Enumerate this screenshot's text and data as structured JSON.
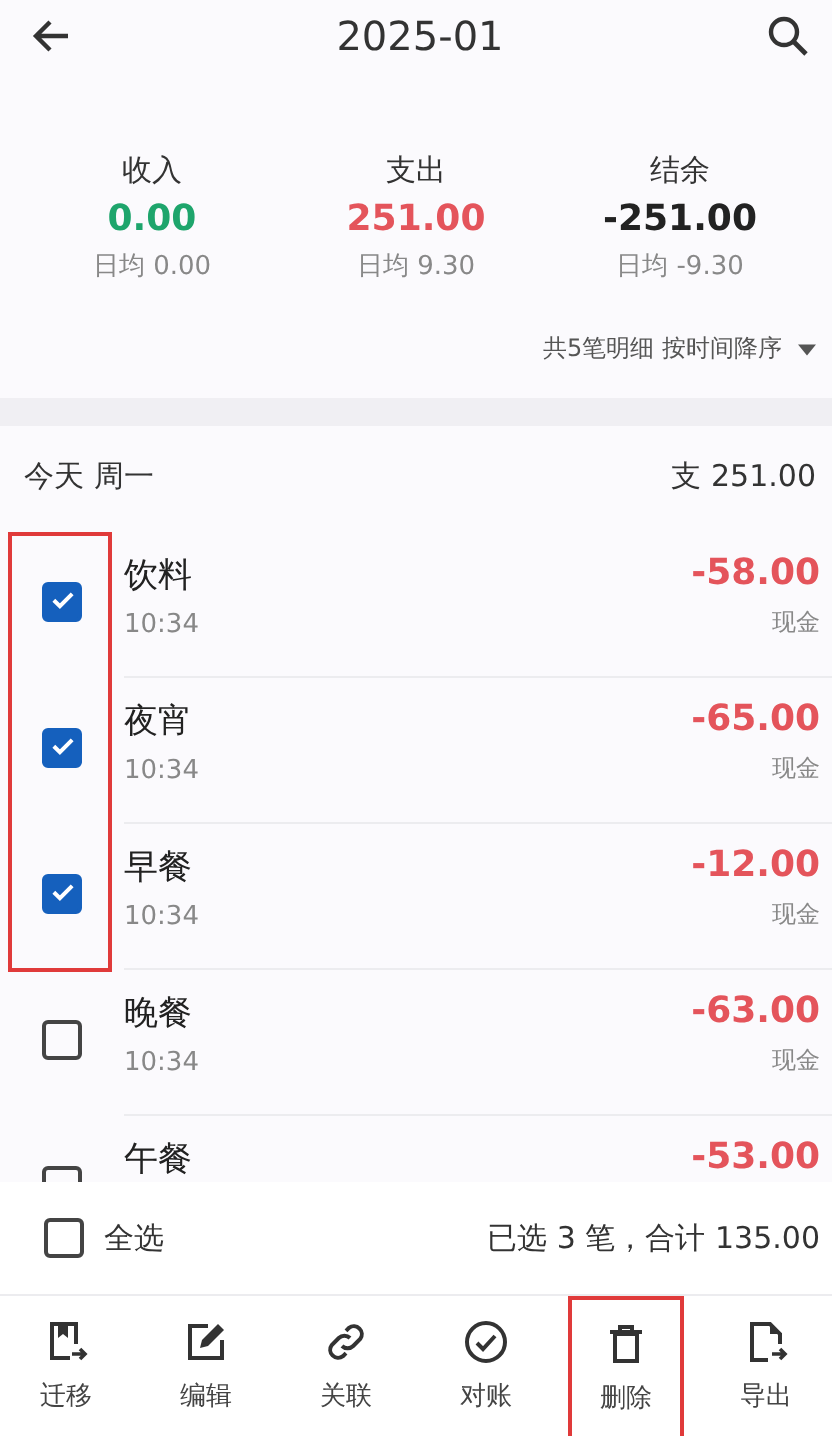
{
  "header": {
    "title": "2025-01"
  },
  "summary": [
    {
      "kind": "income",
      "label": "收入",
      "amount": "0.00",
      "daily": "日均 0.00"
    },
    {
      "kind": "expense",
      "label": "支出",
      "amount": "251.00",
      "daily": "日均 9.30"
    },
    {
      "kind": "balance",
      "label": "结余",
      "amount": "-251.00",
      "daily": "日均 -9.30"
    }
  ],
  "sort_label": "共5笔明细 按时间降序",
  "day": {
    "label": "今天 周一",
    "total": "支 251.00",
    "checkbox_highlight": true
  },
  "entries": [
    {
      "name": "饮料",
      "time": "10:34",
      "amount": "-58.00",
      "account": "现金",
      "checked": true
    },
    {
      "name": "夜宵",
      "time": "10:34",
      "amount": "-65.00",
      "account": "现金",
      "checked": true
    },
    {
      "name": "早餐",
      "time": "10:34",
      "amount": "-12.00",
      "account": "现金",
      "checked": true
    },
    {
      "name": "晚餐",
      "time": "10:34",
      "amount": "-63.00",
      "account": "现金",
      "checked": false
    },
    {
      "name": "午餐",
      "amount": "-53.00",
      "checked": false
    }
  ],
  "select_all": {
    "label": "全选",
    "checked": false,
    "summary": "已选 3 笔，合计 135.00"
  },
  "toolbar": [
    {
      "kind": "move",
      "label": "迁移",
      "highlighted": false
    },
    {
      "kind": "edit",
      "label": "编辑",
      "highlighted": false
    },
    {
      "kind": "link",
      "label": "关联",
      "highlighted": false
    },
    {
      "kind": "reconcile",
      "label": "对账",
      "highlighted": false
    },
    {
      "kind": "delete",
      "label": "删除",
      "highlighted": true
    },
    {
      "kind": "export",
      "label": "导出",
      "highlighted": false
    }
  ]
}
